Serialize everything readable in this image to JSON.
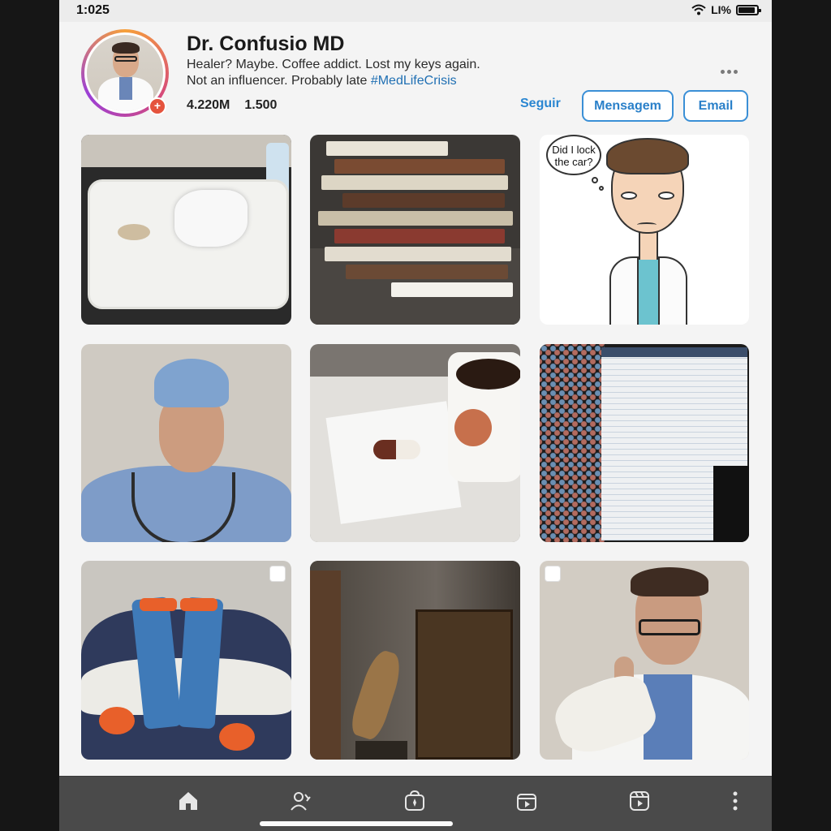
{
  "status_bar": {
    "time": "1:025",
    "signal_text": "LI%"
  },
  "profile": {
    "name": "Dr. Confusio MD",
    "bio_line1": "Healer? Maybe. Coffee addict. Lost my keys again.",
    "bio_line2": "Not an influencer. Probably late ",
    "hashtag": "#MedLifeCrisis",
    "followers": "4.220M",
    "following": "1.500",
    "add_badge": "+"
  },
  "actions": {
    "follow": "Seguir",
    "message": "Mensagem",
    "email": "Email"
  },
  "grid": {
    "cartoon_bubble": "Did I lock the car?"
  },
  "nav": {
    "icons": [
      "home-icon",
      "people-icon",
      "bag-icon",
      "video-icon",
      "reels-icon",
      "more-vertical-icon"
    ]
  },
  "colors": {
    "accent": "#2a86d1",
    "badge": "#e5533d",
    "navbar": "#4a4a4a"
  }
}
